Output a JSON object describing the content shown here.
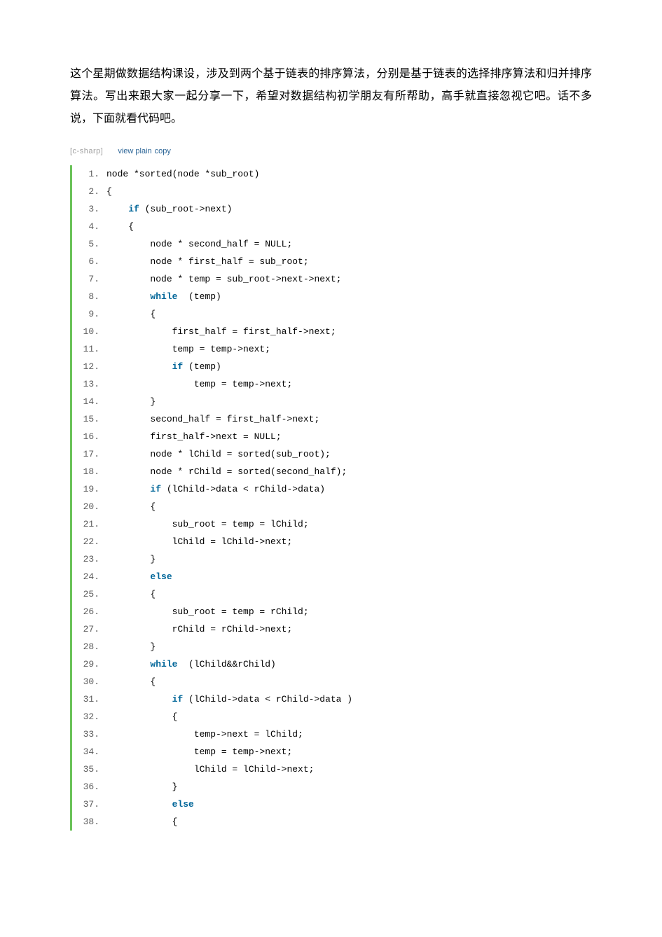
{
  "intro": "这个星期做数据结构课设，涉及到两个基于链表的排序算法，分别是基于链表的选择排序算法和归并排序算法。写出来跟大家一起分享一下，希望对数据结构初学朋友有所帮助，高手就直接忽视它吧。话不多说，下面就看代码吧。",
  "toolbar": {
    "lang": "[c-sharp]",
    "view": "view plain",
    "copy": "copy"
  },
  "code": [
    {
      "n": "1.",
      "segs": [
        {
          "t": "node *sorted(node *sub_root)  "
        }
      ]
    },
    {
      "n": "2.",
      "segs": [
        {
          "t": "{  "
        }
      ]
    },
    {
      "n": "3.",
      "segs": [
        {
          "t": "    "
        },
        {
          "t": "if",
          "kw": true
        },
        {
          "t": " (sub_root->next)  "
        }
      ]
    },
    {
      "n": "4.",
      "segs": [
        {
          "t": "    {  "
        }
      ]
    },
    {
      "n": "5.",
      "segs": [
        {
          "t": "        node * second_half = NULL;  "
        }
      ]
    },
    {
      "n": "6.",
      "segs": [
        {
          "t": "        node * first_half = sub_root;  "
        }
      ]
    },
    {
      "n": "7.",
      "segs": [
        {
          "t": "        node * temp = sub_root->next->next;  "
        }
      ]
    },
    {
      "n": "8.",
      "segs": [
        {
          "t": "        "
        },
        {
          "t": "while",
          "kw": true
        },
        {
          "t": "  (temp)  "
        }
      ]
    },
    {
      "n": "9.",
      "segs": [
        {
          "t": "        {  "
        }
      ]
    },
    {
      "n": "10.",
      "segs": [
        {
          "t": "            first_half = first_half->next;  "
        }
      ]
    },
    {
      "n": "11.",
      "segs": [
        {
          "t": "            temp = temp->next;  "
        }
      ]
    },
    {
      "n": "12.",
      "segs": [
        {
          "t": "            "
        },
        {
          "t": "if",
          "kw": true
        },
        {
          "t": " (temp)  "
        }
      ]
    },
    {
      "n": "13.",
      "segs": [
        {
          "t": "                temp = temp->next;  "
        }
      ]
    },
    {
      "n": "14.",
      "segs": [
        {
          "t": "        }  "
        }
      ]
    },
    {
      "n": "15.",
      "segs": [
        {
          "t": "        second_half = first_half->next;  "
        }
      ]
    },
    {
      "n": "16.",
      "segs": [
        {
          "t": "        first_half->next = NULL;  "
        }
      ]
    },
    {
      "n": "17.",
      "segs": [
        {
          "t": "        node * lChild = sorted(sub_root);  "
        }
      ]
    },
    {
      "n": "18.",
      "segs": [
        {
          "t": "        node * rChild = sorted(second_half);  "
        }
      ]
    },
    {
      "n": "19.",
      "segs": [
        {
          "t": "        "
        },
        {
          "t": "if",
          "kw": true
        },
        {
          "t": " (lChild->data < rChild->data)  "
        }
      ]
    },
    {
      "n": "20.",
      "segs": [
        {
          "t": "        {  "
        }
      ]
    },
    {
      "n": "21.",
      "segs": [
        {
          "t": "            sub_root = temp = lChild;  "
        }
      ]
    },
    {
      "n": "22.",
      "segs": [
        {
          "t": "            lChild = lChild->next;  "
        }
      ]
    },
    {
      "n": "23.",
      "segs": [
        {
          "t": "        }  "
        }
      ]
    },
    {
      "n": "24.",
      "segs": [
        {
          "t": "        "
        },
        {
          "t": "else",
          "kw": true
        },
        {
          "t": "  "
        }
      ]
    },
    {
      "n": "25.",
      "segs": [
        {
          "t": "        {  "
        }
      ]
    },
    {
      "n": "26.",
      "segs": [
        {
          "t": "            sub_root = temp = rChild;  "
        }
      ]
    },
    {
      "n": "27.",
      "segs": [
        {
          "t": "            rChild = rChild->next;  "
        }
      ]
    },
    {
      "n": "28.",
      "segs": [
        {
          "t": "        }  "
        }
      ]
    },
    {
      "n": "29.",
      "segs": [
        {
          "t": "        "
        },
        {
          "t": "while",
          "kw": true
        },
        {
          "t": "  (lChild&&rChild)  "
        }
      ]
    },
    {
      "n": "30.",
      "segs": [
        {
          "t": "        {  "
        }
      ]
    },
    {
      "n": "31.",
      "segs": [
        {
          "t": "            "
        },
        {
          "t": "if",
          "kw": true
        },
        {
          "t": " (lChild->data < rChild->data )  "
        }
      ]
    },
    {
      "n": "32.",
      "segs": [
        {
          "t": "            {  "
        }
      ]
    },
    {
      "n": "33.",
      "segs": [
        {
          "t": "                temp->next = lChild;  "
        }
      ]
    },
    {
      "n": "34.",
      "segs": [
        {
          "t": "                temp = temp->next;  "
        }
      ]
    },
    {
      "n": "35.",
      "segs": [
        {
          "t": "                lChild = lChild->next;  "
        }
      ]
    },
    {
      "n": "36.",
      "segs": [
        {
          "t": "            }  "
        }
      ]
    },
    {
      "n": "37.",
      "segs": [
        {
          "t": "            "
        },
        {
          "t": "else",
          "kw": true
        },
        {
          "t": "  "
        }
      ]
    },
    {
      "n": "38.",
      "segs": [
        {
          "t": "            {  "
        }
      ]
    }
  ]
}
